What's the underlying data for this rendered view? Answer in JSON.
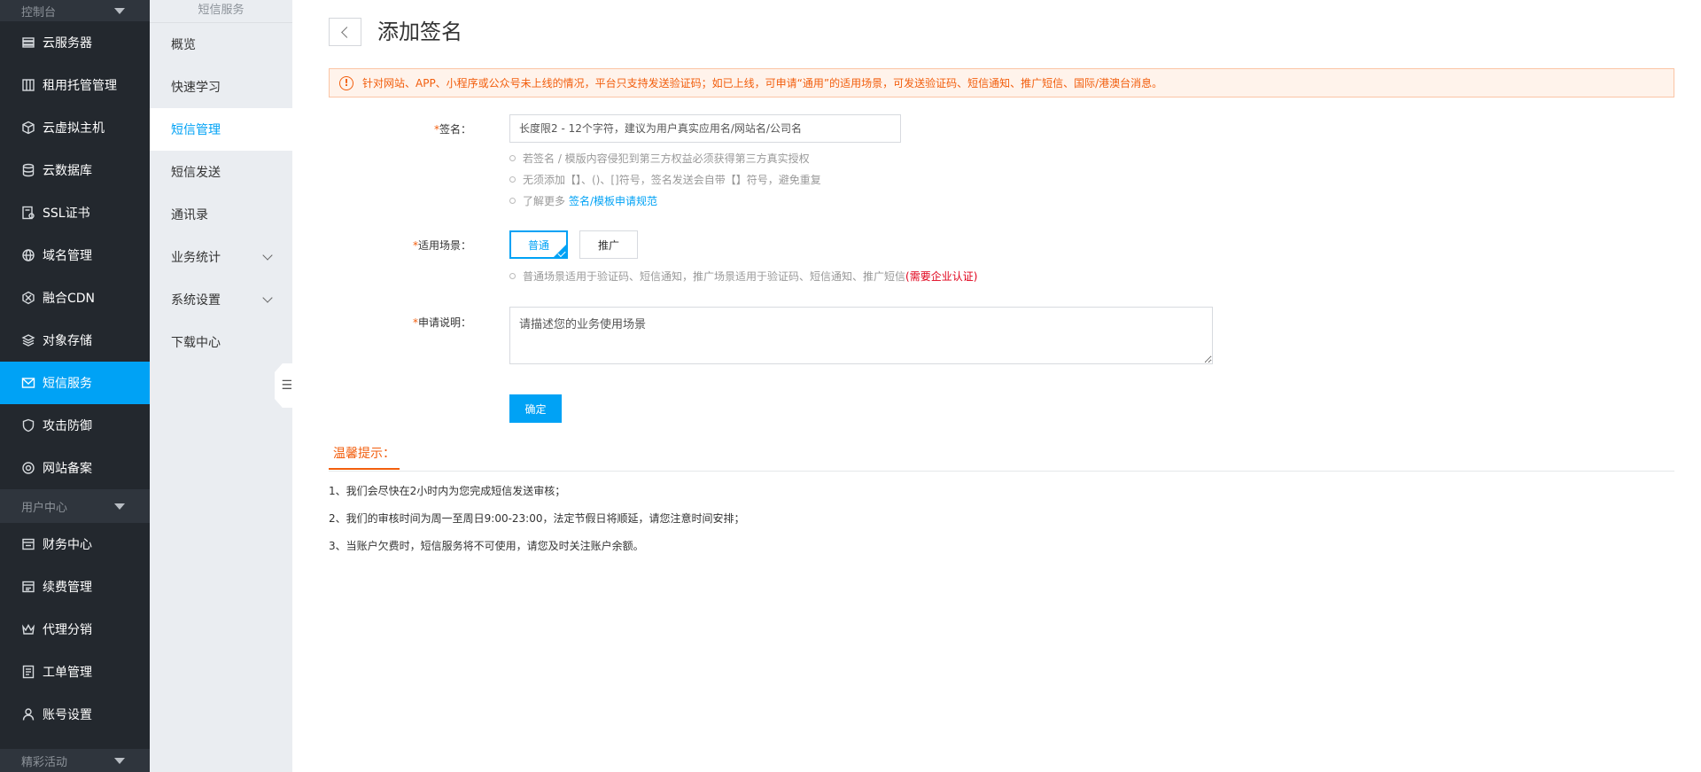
{
  "sidebar": {
    "console_section": "控制台",
    "items": [
      {
        "label": "云服务器",
        "icon": "server-icon"
      },
      {
        "label": "租用托管管理",
        "icon": "hosting-icon"
      },
      {
        "label": "云虚拟主机",
        "icon": "cube-icon"
      },
      {
        "label": "云数据库",
        "icon": "database-icon"
      },
      {
        "label": "SSL证书",
        "icon": "certificate-icon"
      },
      {
        "label": "域名管理",
        "icon": "globe-icon"
      },
      {
        "label": "融合CDN",
        "icon": "cdn-icon"
      },
      {
        "label": "对象存储",
        "icon": "layers-icon"
      },
      {
        "label": "短信服务",
        "icon": "mail-icon",
        "active": true
      },
      {
        "label": "攻击防御",
        "icon": "shield-icon"
      },
      {
        "label": "网站备案",
        "icon": "record-icon"
      }
    ],
    "user_section": "用户中心",
    "user_items": [
      {
        "label": "财务中心",
        "icon": "finance-icon"
      },
      {
        "label": "续费管理",
        "icon": "renew-icon"
      },
      {
        "label": "代理分销",
        "icon": "crown-icon"
      },
      {
        "label": "工单管理",
        "icon": "ticket-icon"
      },
      {
        "label": "账号设置",
        "icon": "user-icon"
      }
    ],
    "activity_section": "精彩活动"
  },
  "subnav": {
    "title": "短信服务",
    "items": [
      {
        "label": "概览"
      },
      {
        "label": "快速学习"
      },
      {
        "label": "短信管理",
        "active": true
      },
      {
        "label": "短信发送"
      },
      {
        "label": "通讯录"
      },
      {
        "label": "业务统计",
        "expandable": true
      },
      {
        "label": "系统设置",
        "expandable": true
      },
      {
        "label": "下载中心"
      }
    ],
    "collapse_icon": "☰"
  },
  "page": {
    "title": "添加签名",
    "alert": "针对网站、APP、小程序或公众号未上线的情况，平台只支持发送验证码；如已上线，可申请“通用”的适用场景，可发送验证码、短信通知、推广短信、国际/港澳台消息。",
    "form": {
      "sign_label": "签名：",
      "sign_placeholder": "长度限2 - 12个字符，建议为用户真实应用名/网站名/公司名",
      "sign_hints": [
        "若签名 / 模版内容侵犯到第三方权益必须获得第三方真实授权",
        "无须添加【】、()、[]符号，签名发送会自带【】符号，避免重复"
      ],
      "learn_more_prefix": "了解更多",
      "learn_more_link": "签名/模板申请规范",
      "scene_label": "适用场景：",
      "scene_options": [
        "普通",
        "推广"
      ],
      "scene_hint": "普通场景适用于验证码、短信通知，推广场景适用于验证码、短信通知、推广短信",
      "scene_hint_note": "(需要企业认证)",
      "desc_label": "申请说明：",
      "desc_placeholder": "请描述您的业务使用场景",
      "required_mark": "*",
      "submit_label": "确定"
    },
    "tips": {
      "title": "温馨提示：",
      "items": [
        "1、我们会尽快在2小时内为您完成短信发送审核；",
        "2、我们的审核时间为周一至周日9:00-23:00，法定节假日将顺延，请您注意时间安排；",
        "3、当账户欠费时，短信服务将不可使用，请您及时关注账户余额。"
      ]
    }
  }
}
